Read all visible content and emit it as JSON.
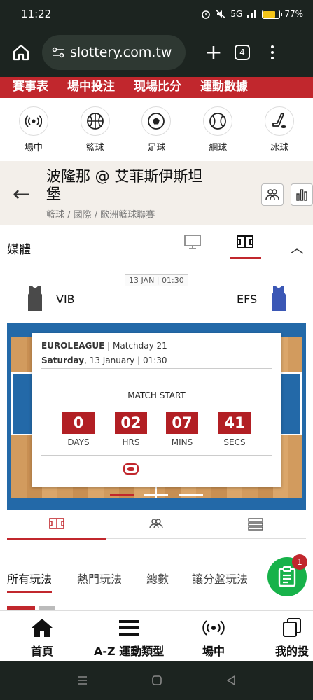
{
  "status_bar": {
    "time": "11:22",
    "network": "5G",
    "battery": "77%",
    "battery_level": 0.77
  },
  "browser": {
    "url": "slottery.com.tw",
    "tab_count": "4"
  },
  "red_nav": [
    "賽事表",
    "場中投注",
    "現場比分",
    "運動數據"
  ],
  "sports": [
    {
      "icon": "live-icon",
      "label": "場中"
    },
    {
      "icon": "basketball-icon",
      "label": "籃球"
    },
    {
      "icon": "soccer-ball-icon",
      "label": "足球"
    },
    {
      "icon": "tennis-ball-icon",
      "label": "網球"
    },
    {
      "icon": "hockey-icon",
      "label": "冰球"
    }
  ],
  "match": {
    "title": "波隆那 @ 艾菲斯伊斯坦堡",
    "breadcrumb": "籃球 / 國際 / 歐洲籃球聯賽"
  },
  "media": {
    "title": "媒體"
  },
  "teams": {
    "date": "13 JAN | 01:30",
    "home": {
      "name": "VIB",
      "color": "#4a4a4a"
    },
    "away": {
      "name": "EFS",
      "color": "#3b57b5"
    }
  },
  "countdown": {
    "league": "EUROLEAGUE",
    "matchday": " | Matchday 21",
    "day": "Saturday",
    "date_rest": ", 13 January | 01:30",
    "heading": "MATCH START",
    "items": [
      {
        "value": "0",
        "unit": "DAYS"
      },
      {
        "value": "02",
        "unit": "HRS"
      },
      {
        "value": "07",
        "unit": "MINS"
      },
      {
        "value": "41",
        "unit": "SECS"
      }
    ]
  },
  "bet_tabs": [
    "所有玩法",
    "熱門玩法",
    "總數",
    "讓分盤玩法"
  ],
  "betslip_badge": "1",
  "bottom_nav": [
    {
      "icon": "home-icon",
      "label": "首頁"
    },
    {
      "icon": "menu-icon",
      "label": "A-Z 運動類型"
    },
    {
      "icon": "live-icon",
      "label": "場中"
    },
    {
      "icon": "my-bets-icon",
      "label": "我的投"
    }
  ],
  "colors": {
    "brand_red": "#c1272d",
    "dark": "#1c2420",
    "fab_green": "#17b24a"
  }
}
